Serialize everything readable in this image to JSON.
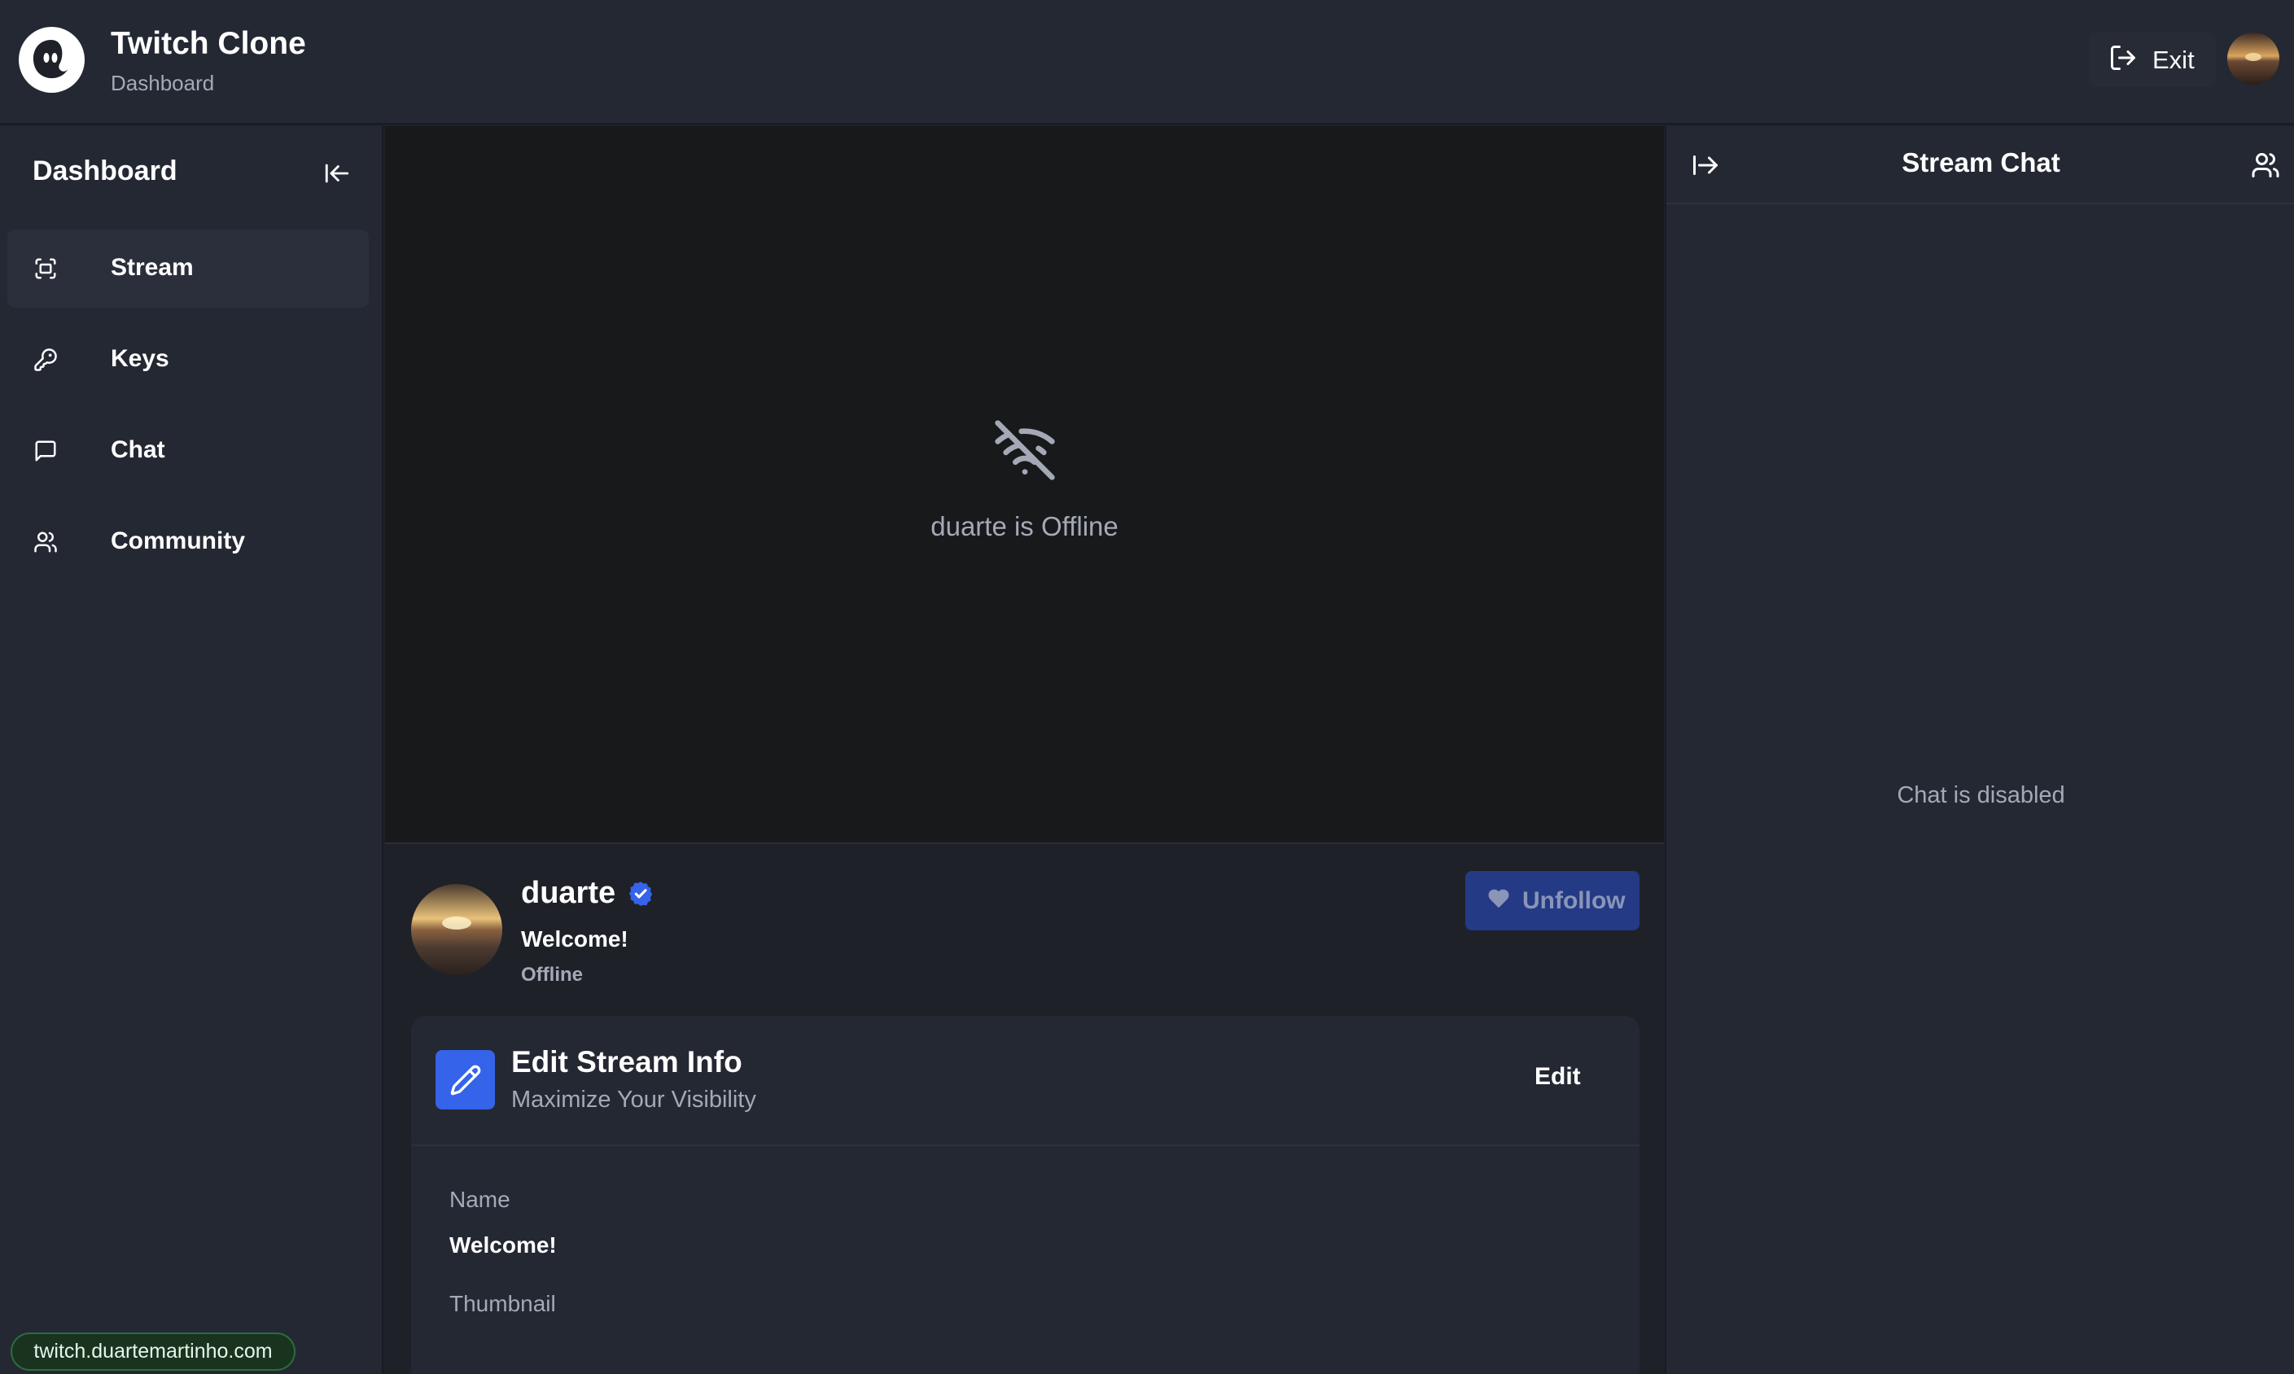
{
  "header": {
    "title": "Twitch Clone",
    "subtitle": "Dashboard",
    "exit_label": "Exit"
  },
  "sidebar": {
    "title": "Dashboard",
    "items": [
      {
        "label": "Stream",
        "icon": "fullscreen-icon",
        "active": true
      },
      {
        "label": "Keys",
        "icon": "key-icon",
        "active": false
      },
      {
        "label": "Chat",
        "icon": "message-square-icon",
        "active": false
      },
      {
        "label": "Community",
        "icon": "users-icon",
        "active": false
      }
    ]
  },
  "player": {
    "offline_message": "duarte is Offline"
  },
  "streamer": {
    "name": "duarte",
    "stream_title": "Welcome!",
    "status": "Offline",
    "unfollow_label": "Unfollow"
  },
  "edit_card": {
    "title": "Edit Stream Info",
    "subtitle": "Maximize Your Visibility",
    "edit_label": "Edit",
    "name_label": "Name",
    "name_value": "Welcome!",
    "thumbnail_label": "Thumbnail"
  },
  "chat": {
    "title": "Stream Chat",
    "disabled_message": "Chat is disabled"
  },
  "footer": {
    "url": "twitch.duartemartinho.com"
  },
  "colors": {
    "background": "#1f2129",
    "panel": "#242833",
    "accent_blue": "#3563e9",
    "unfollow_bg": "#253a85",
    "badge_green": "#2f6b3d"
  }
}
